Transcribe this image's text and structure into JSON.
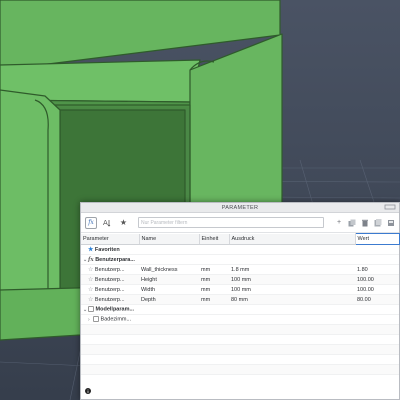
{
  "dialog": {
    "title": "PARAMETER",
    "search_placeholder": "Nur Parameter filtern"
  },
  "toolbar": {
    "fx_label": "fx",
    "add_label": "+",
    "star_label": "★"
  },
  "table": {
    "headers": [
      "Parameter",
      "Name",
      "Einheit",
      "Ausdruck",
      "Wert"
    ],
    "favorites_label": "Favoriten",
    "user_group_label": "Benutzerpara...",
    "model_group_label": "Modellparam...",
    "model_child_label": "Badezimm...",
    "rows": [
      {
        "parameter": "Benutzerp...",
        "name": "Wall_thickness",
        "unit": "mm",
        "expression": "1.8 mm",
        "value": "1.80"
      },
      {
        "parameter": "Benutzerp...",
        "name": "Height",
        "unit": "mm",
        "expression": "100 mm",
        "value": "100.00"
      },
      {
        "parameter": "Benutzerp...",
        "name": "Width",
        "unit": "mm",
        "expression": "100 mm",
        "value": "100.00"
      },
      {
        "parameter": "Benutzerp...",
        "name": "Depth",
        "unit": "mm",
        "expression": "80 mm",
        "value": "80.00"
      }
    ]
  },
  "colors": {
    "model_green": "#62b15a",
    "model_dark": "#3f7a3a",
    "background": "#3e4757",
    "accent_blue": "#3c7bd0"
  }
}
